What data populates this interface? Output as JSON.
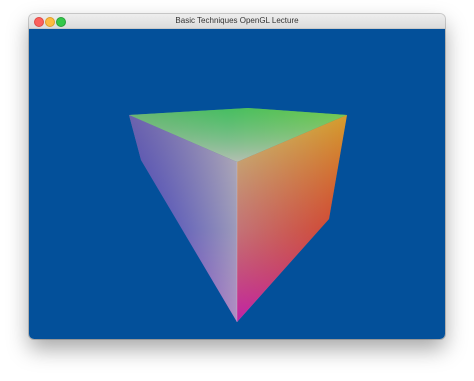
{
  "window": {
    "title": "Basic Techniques OpenGL Lecture",
    "controls": [
      "close",
      "minimize",
      "zoom"
    ]
  },
  "scene": {
    "background_color": "#03509a",
    "object": "rgb-color-cube",
    "face_colors": {
      "top": [
        "#9ea06e",
        "#27c35b",
        "#cfd62f",
        "#c0c0c0"
      ],
      "left_edge": [
        "#c0c0c0",
        "#3c4fa0",
        "#6a0fe0"
      ],
      "right_edge": [
        "#cfd62f",
        "#dd3a10",
        "#b0128c"
      ],
      "bottom_vertex": "#c81ab2"
    }
  }
}
